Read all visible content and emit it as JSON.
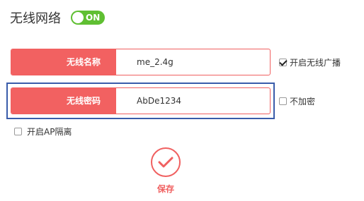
{
  "header": {
    "title": "无线网络",
    "toggle_label": "ON"
  },
  "form": {
    "ssid_label": "无线名称",
    "ssid_value": "me_2.4g",
    "password_label": "无线密码",
    "password_value": "AbDe1234"
  },
  "options": {
    "broadcast_label": "开启无线广播",
    "broadcast_checked": true,
    "no_encrypt_label": "不加密",
    "no_encrypt_checked": false,
    "ap_isolation_label": "开启AP隔离",
    "ap_isolation_checked": false
  },
  "actions": {
    "save_label": "保存"
  },
  "colors": {
    "accent": "#f26161",
    "toggle_on": "#5fbf32",
    "focus_border": "#3a5caa"
  }
}
